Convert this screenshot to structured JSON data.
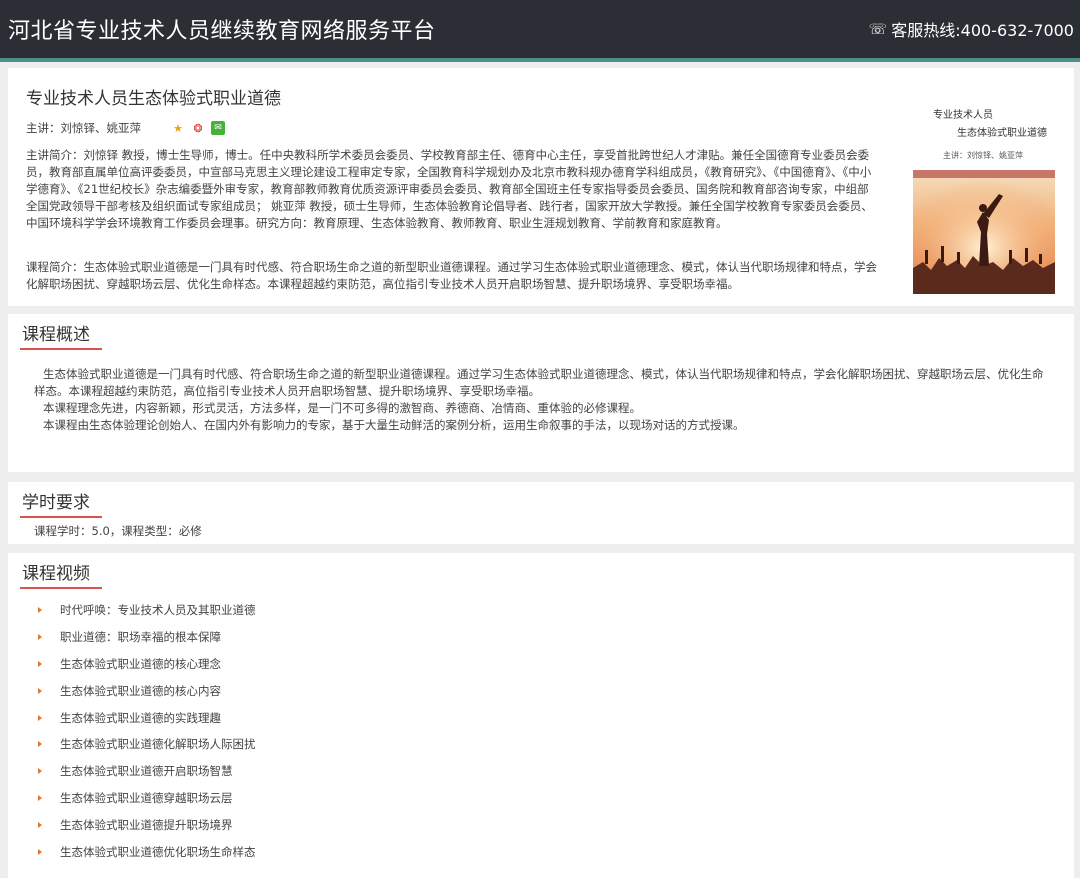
{
  "header": {
    "site_title": "河北省专业技术人员继续教育网络服务平台",
    "hotline_icon": "phone-icon",
    "hotline_label": "客服热线:400-632-7000"
  },
  "course": {
    "title": "专业技术人员生态体验式职业道德",
    "lecturer_label": "主讲：刘惊铎、姚亚萍",
    "share_icons": [
      "star-icon",
      "weibo-icon",
      "wechat-icon"
    ],
    "lecturer_intro": "主讲简介：刘惊铎 教授，博士生导师，博士。任中央教科所学术委员会委员、学校教育部主任、德育中心主任，享受首批跨世纪人才津贴。兼任全国德育专业委员会委员，教育部直属单位高评委委员，中宣部马克思主义理论建设工程审定专家，全国教育科学规划办及北京市教科规办德育学科组成员，《教育研究》、《中国德育》、《中小学德育》、《21世纪校长》杂志编委暨外审专家，教育部教师教育优质资源评审委员会委员、教育部全国班主任专家指导委员会委员、国务院和教育部咨询专家，中组部全国党政领导干部考核及组织面试专家组成员； 姚亚萍 教授，硕士生导师，生态体验教育论倡导者、践行者，国家开放大学教授。兼任全国学校教育专家委员会委员、中国环境科学学会环境教育工作委员会理事。研究方向：教育原理、生态体验教育、教师教育、职业生涯规划教育、学前教育和家庭教育。",
    "course_intro": "课程简介：生态体验式职业道德是一门具有时代感、符合职场生命之道的新型职业道德课程。通过学习生态体验式职业道德理念、模式，体认当代职场规律和特点，学会化解职场困扰、穿越职场云层、优化生命样态。本课程超越约束防范，高位指引专业技术人员开启职场智慧、提升职场境界、享受职场幸福。",
    "cover": {
      "line1": "专业技术人员",
      "line2": "生态体验式职业道德",
      "line3": "主讲：刘惊铎、姚亚萍"
    }
  },
  "overview": {
    "heading": "课程概述",
    "paragraphs": [
      "生态体验式职业道德是一门具有时代感、符合职场生命之道的新型职业道德课程。通过学习生态体验式职业道德理念、模式，体认当代职场规律和特点，学会化解职场困扰、穿越职场云层、优化生命样态。本课程超越约束防范，高位指引专业技术人员开启职场智慧、提升职场境界、享受职场幸福。",
      "本课程理念先进，内容新颖，形式灵活，方法多样，是一门不可多得的激智商、养德商、冶情商、重体验的必修课程。",
      "本课程由生态体验理论创始人、在国内外有影响力的专家，基于大量生动鲜活的案例分析，运用生命叙事的手法，以现场对话的方式授课。"
    ]
  },
  "hours": {
    "heading": "学时要求",
    "text": "课程学时：5.0，课程类型：必修"
  },
  "videos": {
    "heading": "课程视频",
    "items": [
      "时代呼唤：专业技术人员及其职业道德",
      "职业道德：职场幸福的根本保障",
      "生态体验式职业道德的核心理念",
      "生态体验式职业道德的核心内容",
      "生态体验式职业道德的实践理趣",
      "生态体验式职业道德化解职场人际困扰",
      "生态体验式职业道德开启职场智慧",
      "生态体验式职业道德穿越职场云层",
      "生态体验式职业道德提升职场境界",
      "生态体验式职业道德优化职场生命样态"
    ]
  }
}
